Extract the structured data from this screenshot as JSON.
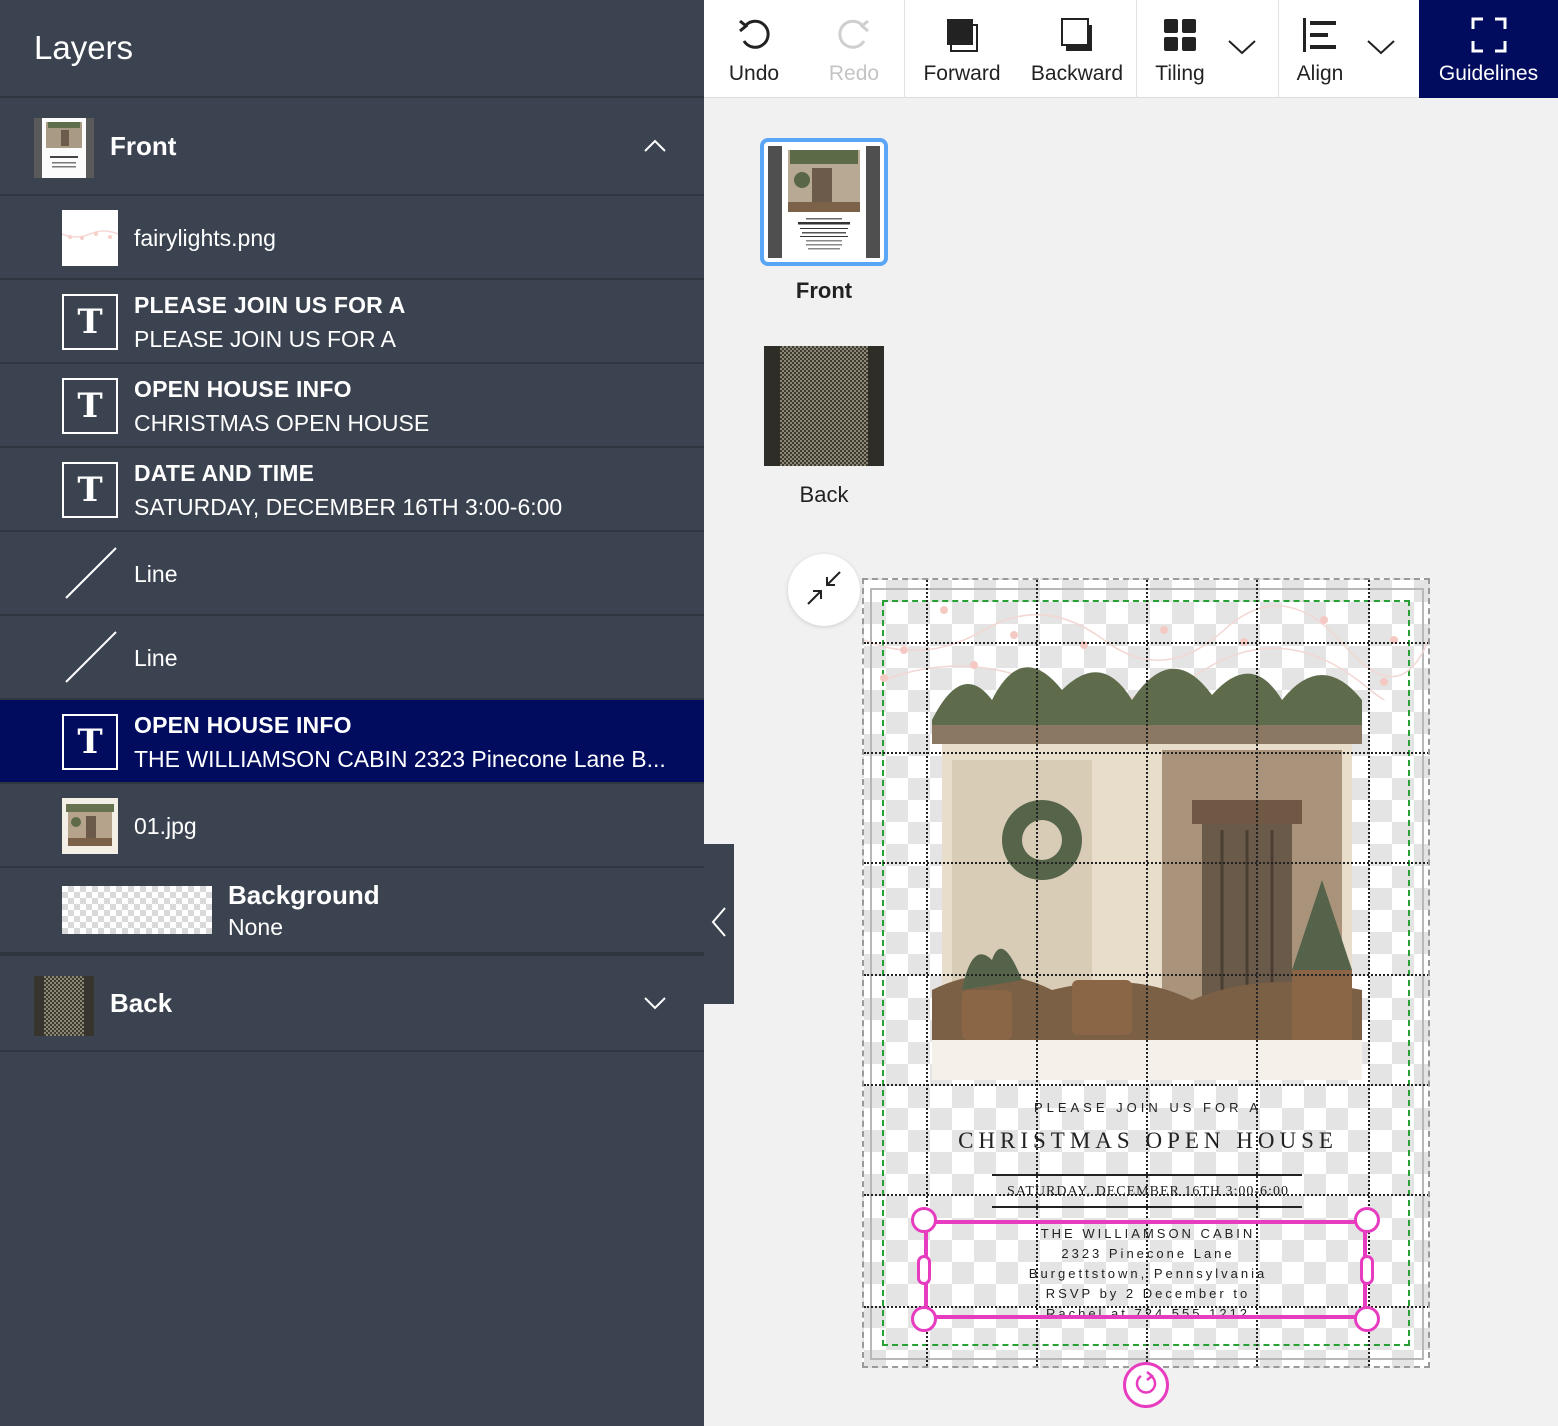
{
  "panel": {
    "title": "Layers",
    "front_group": {
      "label": "Front",
      "expanded": true
    },
    "layers": [
      {
        "kind": "image",
        "title": "fairylights.png"
      },
      {
        "kind": "text",
        "title": "PLEASE JOIN US FOR A",
        "subtitle": "PLEASE JOIN US FOR A"
      },
      {
        "kind": "text",
        "title": "OPEN HOUSE INFO",
        "subtitle": "CHRISTMAS OPEN HOUSE"
      },
      {
        "kind": "text",
        "title": "DATE AND TIME",
        "subtitle": "SATURDAY, DECEMBER 16TH 3:00-6:00"
      },
      {
        "kind": "line",
        "title": "Line"
      },
      {
        "kind": "line",
        "title": "Line"
      },
      {
        "kind": "text",
        "title": "OPEN HOUSE INFO",
        "subtitle": "THE WILLIAMSON CABIN 2323 Pinecone Lane B...",
        "selected": true
      },
      {
        "kind": "image",
        "title": "01.jpg"
      },
      {
        "kind": "background",
        "title": "Background",
        "subtitle": "None"
      }
    ],
    "back_group": {
      "label": "Back",
      "expanded": false
    },
    "text_icon_glyph": "T"
  },
  "toolbar": {
    "undo": "Undo",
    "redo": "Redo",
    "forward": "Forward",
    "backward": "Backward",
    "tiling": "Tiling",
    "align": "Align",
    "guidelines": "Guidelines"
  },
  "pages": {
    "front": "Front",
    "back": "Back",
    "selected": "Front"
  },
  "invitation": {
    "please": "PLEASE JOIN US FOR A",
    "title": "CHRISTMAS OPEN HOUSE",
    "date": "SATURDAY, DECEMBER 16TH 3:00-6:00",
    "address_lines": [
      "THE WILLIAMSON CABIN",
      "2323 Pinecone Lane",
      "Burgettstown, Pennsylvania",
      "RSVP by 2 December to",
      "Rachel at 724.555.1212"
    ]
  },
  "colors": {
    "panel_bg": "#3b4350",
    "selected_bg": "#010c5f",
    "selection_handle": "#e73cc0",
    "safe_area": "#27a036",
    "page_highlight": "#5aa5f5"
  }
}
